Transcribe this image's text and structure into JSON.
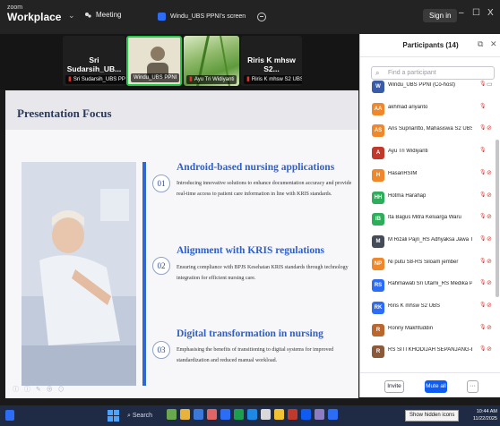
{
  "titlebar": {
    "brand_small": "zoom",
    "brand": "Workplace",
    "meeting_label": "Meeting",
    "share_label": "Windu_UBS PPNI's screen",
    "signin": "Sign in",
    "controls": [
      "–",
      "☐",
      "X"
    ]
  },
  "video_strip": [
    {
      "name": "Sri  Sudarsih_UB...",
      "caption": "Sri Sudarsih_UBS PPNI",
      "active": false
    },
    {
      "name": "",
      "caption": "Windu_UBS PPNI",
      "active": true
    },
    {
      "name": "",
      "caption": "Ayu Tri Widiyanti",
      "active": false
    },
    {
      "name": "Riris K mhsw S2...",
      "caption": "Riris K mhsw S2 UBS",
      "active": false
    }
  ],
  "slide": {
    "title": "Presentation Focus",
    "items": [
      {
        "num": "01",
        "title": "Android-based nursing applications",
        "desc": "Introducing innovative solutions to enhance documentation accuracy and provide real-time access to patient care information in line with KRIS standards."
      },
      {
        "num": "02",
        "title": "Alignment with KRIS regulations",
        "desc": "Ensuring compliance with BPJS Kesehatan KRIS standards through technology integration for efficient nursing care."
      },
      {
        "num": "03",
        "title": "Digital transformation in nursing",
        "desc": "Emphasising the benefits of transitioning to digital systems for improved standardization and reduced manual workload."
      }
    ],
    "footer": "ⓘ ⓘ ✎ ⊕ ⊙"
  },
  "participants": {
    "title": "Participants (14)",
    "search_placeholder": "Find a participant",
    "list": [
      {
        "initials": "W",
        "name": "Windu_UBS PPNI (Co-host)",
        "color": "#3a5ba8",
        "photo": true,
        "cam_off": false,
        "host": true
      },
      {
        "initials": "AA",
        "name": "akhmad ariyanto",
        "color": "#f0872a",
        "photo": false,
        "cam_off": false
      },
      {
        "initials": "AS",
        "name": "Aris Supriantto, Mahasiswa S2 UBS",
        "color": "#f0872a",
        "photo": false,
        "cam_off": true
      },
      {
        "initials": "A",
        "name": "Ayu Tri Widiyanti",
        "color": "#c0392b",
        "photo": true,
        "cam_off": false
      },
      {
        "initials": "H",
        "name": "HasanRSIM",
        "color": "#f0872a",
        "photo": false,
        "cam_off": true
      },
      {
        "initials": "HH",
        "name": "Hotma Harahap",
        "color": "#2eae5a",
        "photo": false,
        "cam_off": true
      },
      {
        "initials": "IB",
        "name": "Ita Bagus Mitra Keluarga Waru",
        "color": "#2eae5a",
        "photo": false,
        "cam_off": true
      },
      {
        "initials": "M",
        "name": "M Rizali Pajri_RS Adhyaksa Jawa Timur",
        "color": "#444b59",
        "photo": true,
        "cam_off": true
      },
      {
        "initials": "NP",
        "name": "Ni putu S8-RS Siloam jember",
        "color": "#f0872a",
        "photo": false,
        "cam_off": true
      },
      {
        "initials": "RS",
        "name": "Rahmawati Sri Utami_RS Medika Pasuruan",
        "color": "#2d6cf5",
        "photo": false,
        "cam_off": true
      },
      {
        "initials": "RK",
        "name": "Riris K mhsw S2 UBS",
        "color": "#2d6cf5",
        "photo": false,
        "cam_off": true
      },
      {
        "initials": "R",
        "name": "Ronny Makhfuddin",
        "color": "#b9662f",
        "photo": true,
        "cam_off": true
      },
      {
        "initials": "R",
        "name": "RS SITI KHODIJAH SEPANJANG-Erma",
        "color": "#8a5a3a",
        "photo": true,
        "cam_off": true
      }
    ],
    "invite": "Invite",
    "mute_all": "Mute all",
    "more": "···"
  },
  "taskbar": {
    "search": "Search",
    "tooltip": "Show hidden icons",
    "time": "10:44 AM",
    "date": "11/22/2025"
  },
  "colors": {
    "accent": "#0e5cf2",
    "slide_title_blue": "#2f5fc8",
    "muted_red": "#e0352d",
    "active_green": "#26c94a"
  }
}
